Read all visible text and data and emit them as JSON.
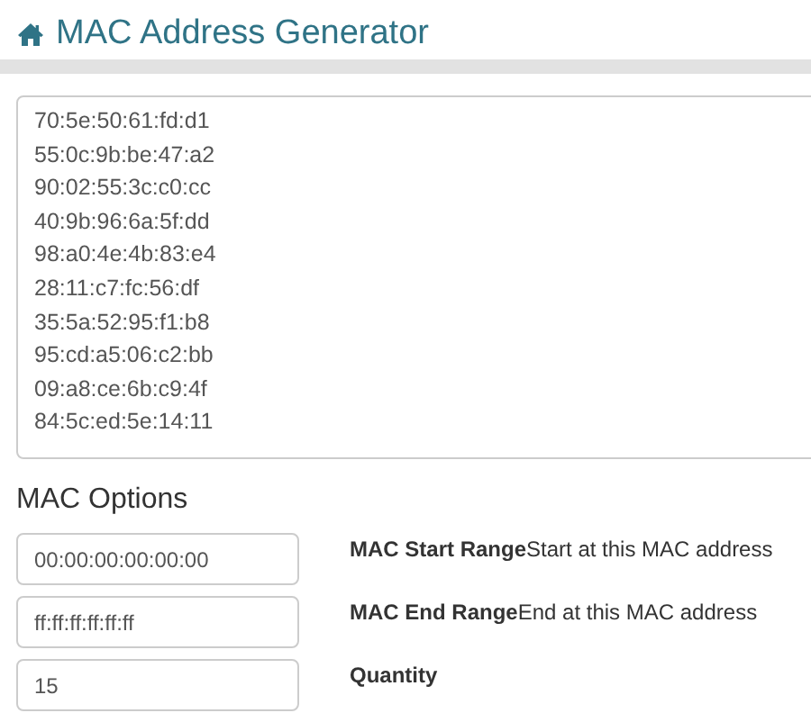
{
  "header": {
    "title": "MAC Address Generator"
  },
  "output": {
    "addresses": [
      "70:5e:50:61:fd:d1",
      "55:0c:9b:be:47:a2",
      "90:02:55:3c:c0:cc",
      "40:9b:96:6a:5f:dd",
      "98:a0:4e:4b:83:e4",
      "28:11:c7:fc:56:df",
      "35:5a:52:95:f1:b8",
      "95:cd:a5:06:c2:bb",
      "09:a8:ce:6b:c9:4f",
      "84:5c:ed:5e:14:11"
    ]
  },
  "options": {
    "title": "MAC Options",
    "fields": [
      {
        "value": "00:00:00:00:00:00",
        "name": "MAC Start Range",
        "description": "Start at this MAC address"
      },
      {
        "value": "ff:ff:ff:ff:ff:ff",
        "name": "MAC End Range",
        "description": "End at this MAC address"
      },
      {
        "value": "15",
        "name": "Quantity"
      }
    ]
  }
}
